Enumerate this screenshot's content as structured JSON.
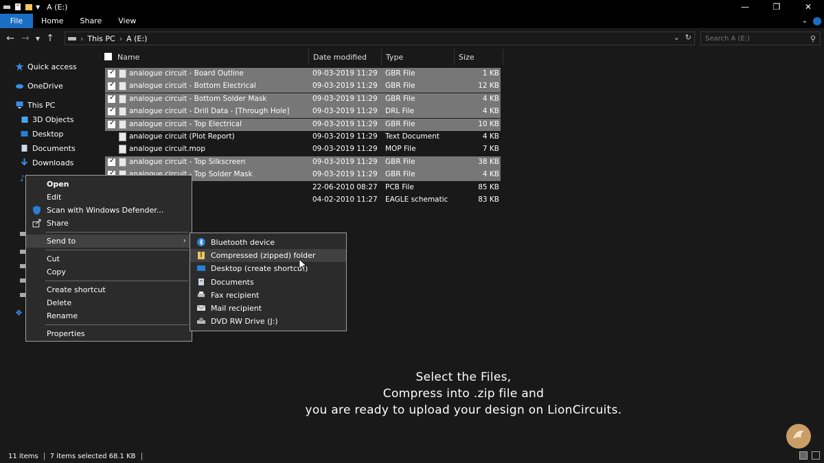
{
  "window": {
    "title": "A (E:)"
  },
  "ribbon": {
    "tabs": [
      "File",
      "Home",
      "Share",
      "View"
    ]
  },
  "address": {
    "crumbs": [
      "This PC",
      "A (E:)"
    ],
    "search_placeholder": "Search A (E:)"
  },
  "sidebar": {
    "items": [
      "Quick access",
      "OneDrive",
      "This PC",
      "3D Objects",
      "Desktop",
      "Documents",
      "Downloads"
    ]
  },
  "columns": {
    "name": "Name",
    "date": "Date modified",
    "type": "Type",
    "size": "Size"
  },
  "files": [
    {
      "name": "analogue circuit - Board Outline",
      "date": "09-03-2019 11:29",
      "type": "GBR File",
      "size": "1 KB",
      "selected": true
    },
    {
      "name": "analogue circuit - Bottom Electrical",
      "date": "09-03-2019 11:29",
      "type": "GBR File",
      "size": "12 KB",
      "selected": true
    },
    {
      "name": "analogue circuit - Bottom Solder Mask",
      "date": "09-03-2019 11:29",
      "type": "GBR File",
      "size": "4 KB",
      "selected": true
    },
    {
      "name": "analogue circuit - Drill Data - [Through Hole]",
      "date": "09-03-2019 11:29",
      "type": "DRL File",
      "size": "4 KB",
      "selected": true
    },
    {
      "name": "analogue circuit - Top Electrical",
      "date": "09-03-2019 11:29",
      "type": "GBR File",
      "size": "10 KB",
      "selected": true
    },
    {
      "name": "analogue circuit (Plot Report)",
      "date": "09-03-2019 11:29",
      "type": "Text Document",
      "size": "4 KB",
      "selected": false
    },
    {
      "name": "analogue circuit.mop",
      "date": "09-03-2019 11:29",
      "type": "MOP File",
      "size": "7 KB",
      "selected": false
    },
    {
      "name": "analogue circuit - Top Silkscreen",
      "date": "09-03-2019 11:29",
      "type": "GBR File",
      "size": "38 KB",
      "selected": true
    },
    {
      "name": "analogue circuit - Top Solder Mask",
      "date": "09-03-2019 11:29",
      "type": "GBR File",
      "size": "4 KB",
      "selected": true
    },
    {
      "name": "",
      "date": "22-06-2010 08:27",
      "type": "PCB File",
      "size": "85 KB",
      "selected": false
    },
    {
      "name": "",
      "date": "04-02-2010 11:27",
      "type": "EAGLE schematic",
      "size": "83 KB",
      "selected": false
    }
  ],
  "context_menu": {
    "open": "Open",
    "edit": "Edit",
    "scan": "Scan with Windows Defender...",
    "share": "Share",
    "send_to": "Send to",
    "cut": "Cut",
    "copy": "Copy",
    "create_shortcut": "Create shortcut",
    "delete": "Delete",
    "rename": "Rename",
    "properties": "Properties"
  },
  "send_to_menu": {
    "items": [
      "Bluetooth device",
      "Compressed (zipped) folder",
      "Desktop (create shortcut)",
      "Documents",
      "Fax recipient",
      "Mail recipient",
      "DVD RW Drive (J:)"
    ]
  },
  "caption": {
    "line1": "Select the Files,",
    "line2": "Compress into .zip file and",
    "line3": "you are ready to upload your design on LionCircuits."
  },
  "status": {
    "items_count": "11 items",
    "selected": "7 items selected  68.1 KB"
  },
  "colors": {
    "accent": "#1a6fc4",
    "background": "#191919",
    "selection": "#777777",
    "menu": "#2b2b2b"
  }
}
